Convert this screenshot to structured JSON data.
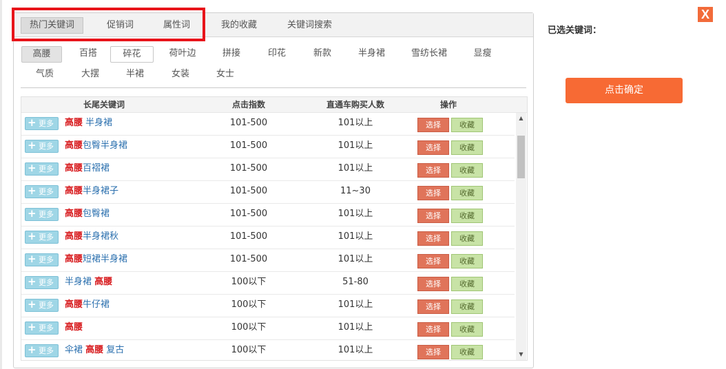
{
  "tabs": [
    {
      "label": "热门关键词",
      "active": true
    },
    {
      "label": "促销词",
      "active": false
    },
    {
      "label": "属性词",
      "active": false
    },
    {
      "label": "我的收藏",
      "active": false
    },
    {
      "label": "关键词搜索",
      "active": false
    }
  ],
  "chips": [
    {
      "label": "高腰",
      "state": "active"
    },
    {
      "label": "百搭",
      "state": "normal"
    },
    {
      "label": "碎花",
      "state": "boxed"
    },
    {
      "label": "荷叶边",
      "state": "normal"
    },
    {
      "label": "拼接",
      "state": "normal"
    },
    {
      "label": "印花",
      "state": "normal"
    },
    {
      "label": "新款",
      "state": "normal"
    },
    {
      "label": "半身裙",
      "state": "normal"
    },
    {
      "label": "雪纺长裙",
      "state": "normal"
    },
    {
      "label": "显瘦",
      "state": "normal"
    },
    {
      "label": "气质",
      "state": "normal"
    },
    {
      "label": "大摆",
      "state": "normal"
    },
    {
      "label": "半裙",
      "state": "normal"
    },
    {
      "label": "女装",
      "state": "normal"
    },
    {
      "label": "女士",
      "state": "normal"
    }
  ],
  "table": {
    "headers": {
      "keyword": "长尾关键词",
      "clicks": "点击指数",
      "buyers": "直通车购买人数",
      "action": "操作"
    },
    "more_label": "更多",
    "select_label": "选择",
    "fav_label": "收藏",
    "rows": [
      {
        "parts": [
          {
            "t": "高腰",
            "h": true
          },
          {
            "t": " 半身裙",
            "h": false
          }
        ],
        "clicks": "101-500",
        "buyers": "101以上"
      },
      {
        "parts": [
          {
            "t": "高腰",
            "h": true
          },
          {
            "t": "包臀半身裙",
            "h": false
          }
        ],
        "clicks": "101-500",
        "buyers": "101以上"
      },
      {
        "parts": [
          {
            "t": "高腰",
            "h": true
          },
          {
            "t": "百褶裙",
            "h": false
          }
        ],
        "clicks": "101-500",
        "buyers": "101以上"
      },
      {
        "parts": [
          {
            "t": "高腰",
            "h": true
          },
          {
            "t": "半身裙子",
            "h": false
          }
        ],
        "clicks": "101-500",
        "buyers": "11~30"
      },
      {
        "parts": [
          {
            "t": "高腰",
            "h": true
          },
          {
            "t": "包臀裙",
            "h": false
          }
        ],
        "clicks": "101-500",
        "buyers": "101以上"
      },
      {
        "parts": [
          {
            "t": "高腰",
            "h": true
          },
          {
            "t": "半身裙秋",
            "h": false
          }
        ],
        "clicks": "101-500",
        "buyers": "101以上"
      },
      {
        "parts": [
          {
            "t": "高腰",
            "h": true
          },
          {
            "t": "短裙半身裙",
            "h": false
          }
        ],
        "clicks": "101-500",
        "buyers": "101以上"
      },
      {
        "parts": [
          {
            "t": "半身裙 ",
            "h": false
          },
          {
            "t": "高腰",
            "h": true
          }
        ],
        "clicks": "100以下",
        "buyers": "51-80"
      },
      {
        "parts": [
          {
            "t": "高腰",
            "h": true
          },
          {
            "t": "牛仔裙",
            "h": false
          }
        ],
        "clicks": "100以下",
        "buyers": "101以上"
      },
      {
        "parts": [
          {
            "t": "高腰",
            "h": true
          }
        ],
        "clicks": "100以下",
        "buyers": "101以上"
      },
      {
        "parts": [
          {
            "t": "伞裙 ",
            "h": false
          },
          {
            "t": "高腰",
            "h": true
          },
          {
            "t": " 复古",
            "h": false
          }
        ],
        "clicks": "100以下",
        "buyers": "101以上"
      }
    ]
  },
  "sidebar": {
    "close_label": "X",
    "selected_label": "已选关键词：",
    "confirm_label": "点击确定"
  },
  "colors": {
    "highlight_box": "#e8141a",
    "confirm": "#f76a34",
    "keyword_highlight": "#d7191c",
    "keyword_normal": "#2a6fae"
  }
}
